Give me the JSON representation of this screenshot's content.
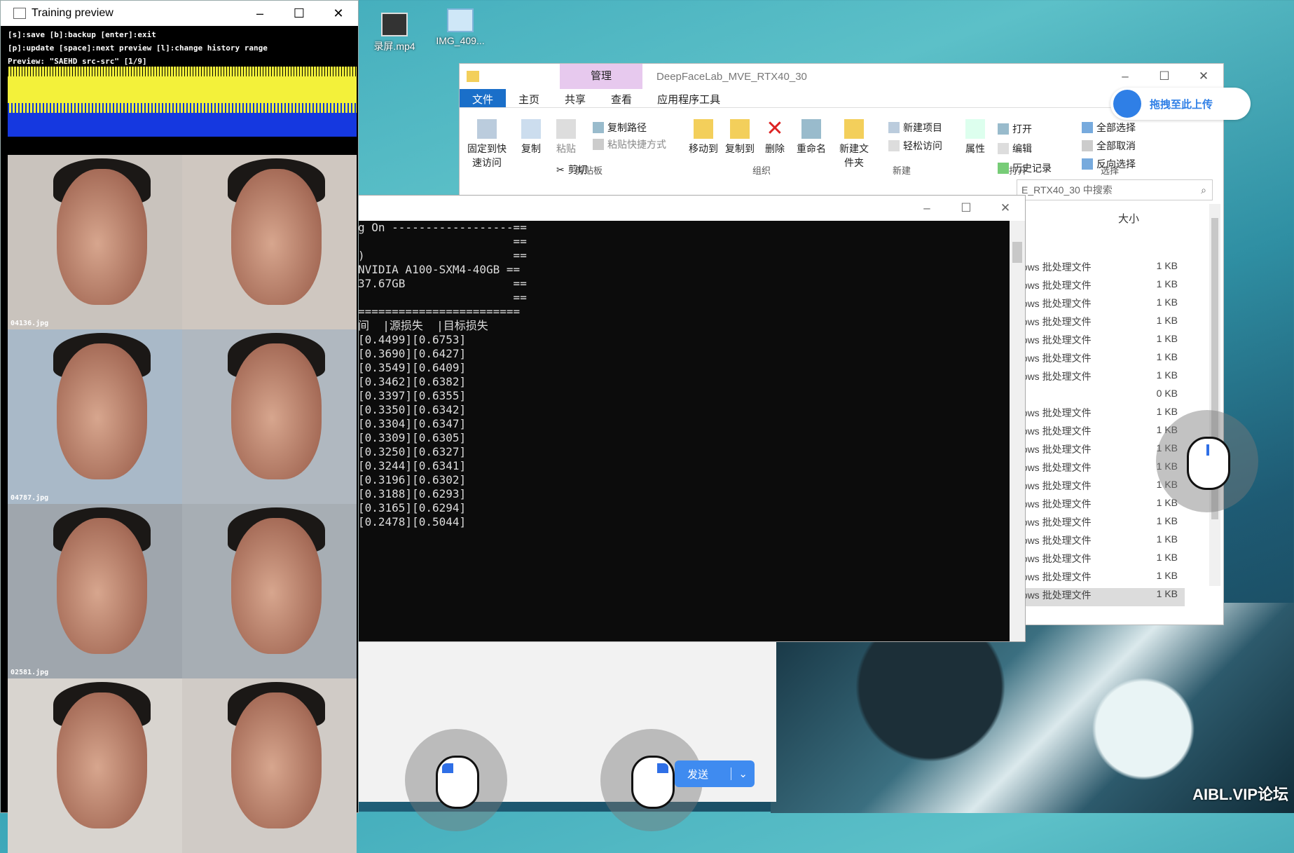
{
  "desktop": {
    "icons": [
      {
        "label": "录屏.mp4"
      },
      {
        "label": "IMG_409..."
      }
    ],
    "watermark": "AIBL.VIP论坛"
  },
  "training_preview": {
    "title": "Training preview",
    "help_lines": [
      "[s]:save [b]:backup [enter]:exit",
      "[p]:update [space]:next preview [l]:change history range",
      "Preview: \"SAEHD src-src\" [1/9]"
    ],
    "face_labels": [
      "04136.jpg",
      "04787.jpg",
      "02581.jpg"
    ]
  },
  "explorer": {
    "context_tab": "管理",
    "title": "DeepFaceLab_MVE_RTX40_30",
    "tabs": [
      "文件",
      "主页",
      "共享",
      "查看",
      "应用程序工具"
    ],
    "ribbon": {
      "pin": "固定到快速访问",
      "copy": "复制",
      "paste": "粘贴",
      "copy_path": "复制路径",
      "paste_shortcut": "粘贴快捷方式",
      "cut": "剪切",
      "move_to": "移动到",
      "copy_to": "复制到",
      "delete": "删除",
      "rename": "重命名",
      "new_folder": "新建文件夹",
      "new_item": "新建项目",
      "easy_access": "轻松访问",
      "properties": "属性",
      "open": "打开",
      "edit": "编辑",
      "history": "历史记录",
      "select_all": "全部选择",
      "select_none": "全部取消",
      "invert": "反向选择",
      "groups": [
        "剪贴板",
        "组织",
        "新建",
        "打开",
        "选择"
      ]
    },
    "upload_label": "拖拽至此上传",
    "search_placeholder": "E_RTX40_30 中搜索",
    "column_size": "大小",
    "files": [
      {
        "type": "dows 批处理文件",
        "size": "1 KB"
      },
      {
        "type": "dows 批处理文件",
        "size": "1 KB"
      },
      {
        "type": "dows 批处理文件",
        "size": "1 KB"
      },
      {
        "type": "dows 批处理文件",
        "size": "1 KB"
      },
      {
        "type": "dows 批处理文件",
        "size": "1 KB"
      },
      {
        "type": "dows 批处理文件",
        "size": "1 KB"
      },
      {
        "type": "dows 批处理文件",
        "size": "1 KB"
      },
      {
        "type": "",
        "size": "0 KB"
      },
      {
        "type": "dows 批处理文件",
        "size": "1 KB"
      },
      {
        "type": "dows 批处理文件",
        "size": "1 KB"
      },
      {
        "type": "dows 批处理文件",
        "size": "1 KB"
      },
      {
        "type": "dows 批处理文件",
        "size": "1 KB"
      },
      {
        "type": "dows 批处理文件",
        "size": "1 KB"
      },
      {
        "type": "dows 批处理文件",
        "size": "1 KB"
      },
      {
        "type": "dows 批处理文件",
        "size": "1 KB"
      },
      {
        "type": "dows 批处理文件",
        "size": "1 KB"
      },
      {
        "type": "dows 批处理文件",
        "size": "1 KB"
      },
      {
        "type": "dows 批处理文件",
        "size": "1 KB"
      },
      {
        "type": "dows 批处理文件",
        "size": "1 KB"
      }
    ]
  },
  "console": {
    "lines": [
      "g On ------------------==",
      "                       ==",
      ")                      ==",
      "NVIDIA A100-SXM4-40GB ==",
      "37.67GB                ==",
      "                       ==",
      "========================",
      "",
      "",
      "",
      "",
      "",
      "间  |源损失  |目标损失",
      "",
      "[0.4499][0.6753]",
      "[0.3690][0.6427]",
      "[0.3549][0.6409]",
      "[0.3462][0.6382]",
      "[0.3397][0.6355]",
      "[0.3350][0.6342]",
      "[0.3304][0.6347]",
      "[0.3309][0.6305]",
      "[0.3250][0.6327]",
      "[0.3244][0.6341]",
      "[0.3196][0.6302]",
      "[0.3188][0.6293]",
      "[0.3165][0.6294]",
      "[0.2478][0.5044]"
    ]
  },
  "chat": {
    "send_label": "发送"
  }
}
